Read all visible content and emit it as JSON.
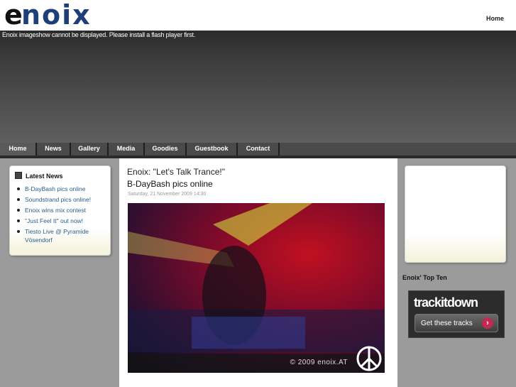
{
  "header": {
    "logo_text": "enoix",
    "home_link": "Home"
  },
  "flash": {
    "message": "Enoix imageshow cannot be displayed. Please install a flash player first."
  },
  "nav": {
    "items": [
      {
        "label": "Home",
        "active": true
      },
      {
        "label": "News",
        "active": false
      },
      {
        "label": "Gallery",
        "active": false
      },
      {
        "label": "Media",
        "active": false
      },
      {
        "label": "Goodies",
        "active": false
      },
      {
        "label": "Guestbook",
        "active": false
      },
      {
        "label": "Contact",
        "active": false
      }
    ]
  },
  "latest_news": {
    "title": "Latest News",
    "items": [
      "B-DayBash pics online",
      "Soundstrand pics online!",
      "Enoix wins mix contest",
      "\"Just Feel It\" out now!",
      "Tiesto Live @ Pyramide Vösendorf"
    ]
  },
  "article": {
    "heading": "Enoix: \"Let's Talk Trance!\"",
    "title": "B-DayBash pics online",
    "date": "Saturday, 21 November 2009 14:30",
    "photo_caption": "© 2009 enoix.AT"
  },
  "sidebar_right": {
    "top_ten_title": "Enoix' Top Ten",
    "trackitdown_logo": "trackitdown",
    "trackitdown_button": "Get these tracks"
  },
  "colors": {
    "logo_blue": "#1f3f7a",
    "logo_black": "#111111",
    "link": "#2a5d8a",
    "accent_pink": "#c22a52"
  }
}
